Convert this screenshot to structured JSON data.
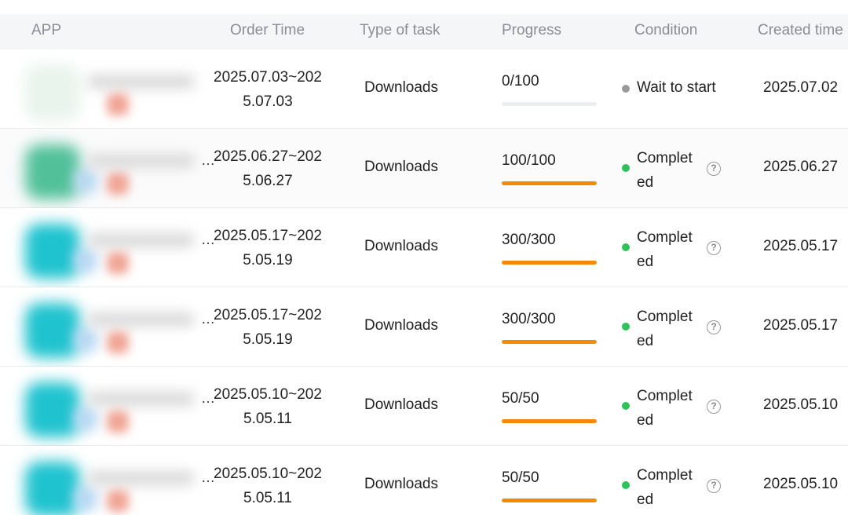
{
  "columns": {
    "app": "APP",
    "order_time": "Order Time",
    "type": "Type of task",
    "progress": "Progress",
    "condition": "Condition",
    "created": "Created time"
  },
  "colors": {
    "progress_fill": "#f38a06",
    "status_wait": "#999999",
    "status_done": "#2fc15a"
  },
  "rows": [
    {
      "order_line1": "2025.07.03~202",
      "order_line2": "5.07.03",
      "ellipsis": "",
      "type": "Downloads",
      "progress_label": "0/100",
      "progress_fraction": 0.0,
      "condition": "Wait to start",
      "status": "wait",
      "created": "2025.07.02",
      "icon_color": "#e8f4ec"
    },
    {
      "order_line1": "2025.06.27~202",
      "order_line2": "5.06.27",
      "ellipsis": "…",
      "type": "Downloads",
      "progress_label": "100/100",
      "progress_fraction": 1.0,
      "condition": "Completed",
      "status": "done",
      "created": "2025.06.27",
      "icon_color": "#52c19a"
    },
    {
      "order_line1": "2025.05.17~202",
      "order_line2": "5.05.19",
      "ellipsis": "…",
      "type": "Downloads",
      "progress_label": "300/300",
      "progress_fraction": 1.0,
      "condition": "Completed",
      "status": "done",
      "created": "2025.05.17",
      "icon_color": "#1fc3cf"
    },
    {
      "order_line1": "2025.05.17~202",
      "order_line2": "5.05.19",
      "ellipsis": "…",
      "type": "Downloads",
      "progress_label": "300/300",
      "progress_fraction": 1.0,
      "condition": "Completed",
      "status": "done",
      "created": "2025.05.17",
      "icon_color": "#1fc3cf"
    },
    {
      "order_line1": "2025.05.10~202",
      "order_line2": "5.05.11",
      "ellipsis": "…",
      "type": "Downloads",
      "progress_label": "50/50",
      "progress_fraction": 1.0,
      "condition": "Completed",
      "status": "done",
      "created": "2025.05.10",
      "icon_color": "#1fc3cf"
    },
    {
      "order_line1": "2025.05.10~202",
      "order_line2": "5.05.11",
      "ellipsis": "…",
      "type": "Downloads",
      "progress_label": "50/50",
      "progress_fraction": 1.0,
      "condition": "Completed",
      "status": "done",
      "created": "2025.05.10",
      "icon_color": "#1fc3cf"
    }
  ],
  "help_glyph": "?"
}
